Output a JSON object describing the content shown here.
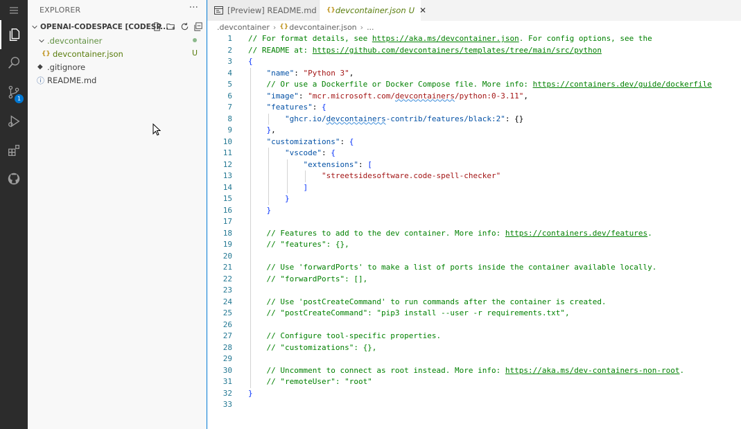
{
  "sidebar": {
    "title": "EXPLORER",
    "more": "···",
    "folder": "OPENAI-CODESPACE [CODESP...",
    "tree": [
      {
        "label": ".devcontainer",
        "status": "dot"
      },
      {
        "label": "devcontainer.json",
        "status": "U"
      },
      {
        "label": ".gitignore",
        "status": ""
      },
      {
        "label": "README.md",
        "status": ""
      }
    ]
  },
  "activity": {
    "scm_badge": "1"
  },
  "tabs": [
    {
      "label": "[Preview] README.md"
    },
    {
      "label": "devcontainer.json",
      "status": "U",
      "close": "✕"
    }
  ],
  "breadcrumb": [
    ".devcontainer",
    "devcontainer.json",
    "..."
  ],
  "editor": {
    "line_numbers": [
      "1",
      "2",
      "3",
      "4",
      "5",
      "6",
      "7",
      "8",
      "9",
      "10",
      "11",
      "12",
      "13",
      "14",
      "15",
      "16",
      "17",
      "18",
      "19",
      "20",
      "21",
      "22",
      "23",
      "24",
      "25",
      "26",
      "27",
      "28",
      "29",
      "30",
      "31",
      "32",
      "33"
    ],
    "lines": [
      [
        {
          "t": "// For format details, see ",
          "c": "cmt"
        },
        {
          "t": "https://aka.ms/devcontainer.json",
          "c": "url"
        },
        {
          "t": ". For config options, see the",
          "c": "cmt"
        }
      ],
      [
        {
          "t": "// README at: ",
          "c": "cmt"
        },
        {
          "t": "https://github.com/devcontainers/templates/tree/main/src/python",
          "c": "url"
        }
      ],
      [
        {
          "t": "{",
          "c": "brk"
        }
      ],
      [
        {
          "t": "    ",
          "c": "punc"
        },
        {
          "t": "\"name\"",
          "c": "key"
        },
        {
          "t": ": ",
          "c": "punc"
        },
        {
          "t": "\"Python 3\"",
          "c": "str"
        },
        {
          "t": ",",
          "c": "punc"
        }
      ],
      [
        {
          "t": "    // Or use a Dockerfile or Docker Compose file. More info: ",
          "c": "cmt"
        },
        {
          "t": "https://containers.dev/guide/dockerfile",
          "c": "url"
        }
      ],
      [
        {
          "t": "    ",
          "c": "punc"
        },
        {
          "t": "\"image\"",
          "c": "key"
        },
        {
          "t": ": ",
          "c": "punc"
        },
        {
          "t": "\"mcr.microsoft.com/",
          "c": "str"
        },
        {
          "t": "devcontainers",
          "c": "str squig"
        },
        {
          "t": "/python:0-3.11\"",
          "c": "str"
        },
        {
          "t": ",",
          "c": "punc"
        }
      ],
      [
        {
          "t": "    ",
          "c": "punc"
        },
        {
          "t": "\"features\"",
          "c": "key"
        },
        {
          "t": ": ",
          "c": "punc"
        },
        {
          "t": "{",
          "c": "brk"
        }
      ],
      [
        {
          "t": "        ",
          "c": "punc"
        },
        {
          "t": "\"ghcr.io/",
          "c": "key"
        },
        {
          "t": "devcontainers",
          "c": "key squig"
        },
        {
          "t": "-contrib/features/black:2\"",
          "c": "key"
        },
        {
          "t": ": {}",
          "c": "punc"
        }
      ],
      [
        {
          "t": "    ",
          "c": "punc"
        },
        {
          "t": "}",
          "c": "brk"
        },
        {
          "t": ",",
          "c": "punc"
        }
      ],
      [
        {
          "t": "    ",
          "c": "punc"
        },
        {
          "t": "\"customizations\"",
          "c": "key"
        },
        {
          "t": ": ",
          "c": "punc"
        },
        {
          "t": "{",
          "c": "brk"
        }
      ],
      [
        {
          "t": "        ",
          "c": "punc"
        },
        {
          "t": "\"vscode\"",
          "c": "key"
        },
        {
          "t": ": ",
          "c": "punc"
        },
        {
          "t": "{",
          "c": "brk"
        }
      ],
      [
        {
          "t": "            ",
          "c": "punc"
        },
        {
          "t": "\"extensions\"",
          "c": "key"
        },
        {
          "t": ": ",
          "c": "punc"
        },
        {
          "t": "[",
          "c": "brk"
        }
      ],
      [
        {
          "t": "                ",
          "c": "punc"
        },
        {
          "t": "\"streetsidesoftware.code-spell-checker\"",
          "c": "str"
        }
      ],
      [
        {
          "t": "            ",
          "c": "punc"
        },
        {
          "t": "]",
          "c": "brk"
        }
      ],
      [
        {
          "t": "        ",
          "c": "punc"
        },
        {
          "t": "}",
          "c": "brk"
        }
      ],
      [
        {
          "t": "    ",
          "c": "punc"
        },
        {
          "t": "}",
          "c": "brk"
        }
      ],
      [],
      [
        {
          "t": "    // Features to add to the dev container. More info: ",
          "c": "cmt"
        },
        {
          "t": "https://containers.dev/features",
          "c": "url"
        },
        {
          "t": ".",
          "c": "cmt"
        }
      ],
      [
        {
          "t": "    // \"features\": {},",
          "c": "cmt"
        }
      ],
      [],
      [
        {
          "t": "    // Use 'forwardPorts' to make a list of ports inside the container available locally.",
          "c": "cmt"
        }
      ],
      [
        {
          "t": "    // \"forwardPorts\": [],",
          "c": "cmt"
        }
      ],
      [],
      [
        {
          "t": "    // Use 'postCreateCommand' to run commands after the container is created.",
          "c": "cmt"
        }
      ],
      [
        {
          "t": "    // \"postCreateCommand\": \"pip3 install --user -r requirements.txt\",",
          "c": "cmt"
        }
      ],
      [],
      [
        {
          "t": "    // Configure tool-specific properties.",
          "c": "cmt"
        }
      ],
      [
        {
          "t": "    // \"customizations\": {},",
          "c": "cmt"
        }
      ],
      [],
      [
        {
          "t": "    // Uncomment to connect as root instead. More info: ",
          "c": "cmt"
        },
        {
          "t": "https://aka.ms/dev-containers-non-root",
          "c": "url"
        },
        {
          "t": ".",
          "c": "cmt"
        }
      ],
      [
        {
          "t": "    // \"remoteUser\": \"root\"",
          "c": "cmt"
        }
      ],
      [
        {
          "t": "}",
          "c": "brk"
        }
      ],
      []
    ]
  }
}
